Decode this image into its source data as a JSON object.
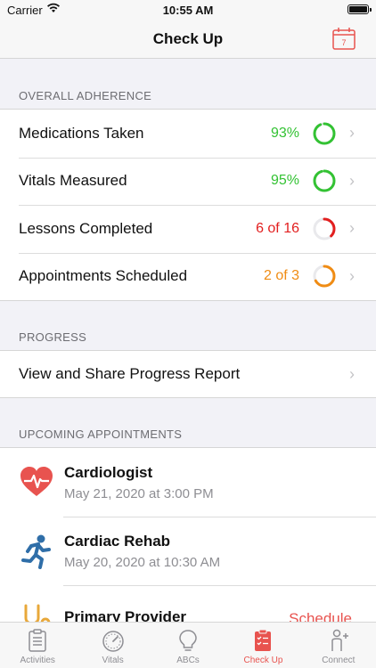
{
  "status_bar": {
    "carrier": "Carrier",
    "time": "10:55 AM"
  },
  "nav": {
    "title": "Check Up",
    "calendar_day": "7"
  },
  "sections": {
    "adherence": {
      "header": "OVERALL ADHERENCE",
      "rows": [
        {
          "label": "Medications Taken",
          "value": "93%",
          "progress": 0.93,
          "color": "#33c233"
        },
        {
          "label": "Vitals Measured",
          "value": "95%",
          "progress": 0.95,
          "color": "#33c233"
        },
        {
          "label": "Lessons Completed",
          "value": "6 of 16",
          "progress": 0.375,
          "color": "#e21f1f"
        },
        {
          "label": "Appointments Scheduled",
          "value": "2 of 3",
          "progress": 0.667,
          "color": "#f08c14"
        }
      ]
    },
    "progress": {
      "header": "PROGRESS",
      "row_label": "View and Share Progress Report"
    },
    "appointments": {
      "header": "UPCOMING APPOINTMENTS",
      "items": [
        {
          "name": "Cardiologist",
          "date": "May 21, 2020 at 3:00 PM",
          "icon": "heart-icon"
        },
        {
          "name": "Cardiac Rehab",
          "date": "May 20, 2020 at 10:30 AM",
          "icon": "runner-icon"
        },
        {
          "name": "Primary Provider",
          "date": "",
          "icon": "stethoscope-icon",
          "action": "Schedule"
        }
      ]
    }
  },
  "tabs": [
    {
      "label": "Activities",
      "icon": "clipboard-icon",
      "active": false
    },
    {
      "label": "Vitals",
      "icon": "gauge-icon",
      "active": false
    },
    {
      "label": "ABCs",
      "icon": "lightbulb-icon",
      "active": false
    },
    {
      "label": "Check Up",
      "icon": "checklist-icon",
      "active": true
    },
    {
      "label": "Connect",
      "icon": "person-add-icon",
      "active": false
    }
  ],
  "colors": {
    "accent": "#e8534f",
    "green": "#33c233",
    "red": "#e21f1f",
    "orange": "#f08c14"
  }
}
